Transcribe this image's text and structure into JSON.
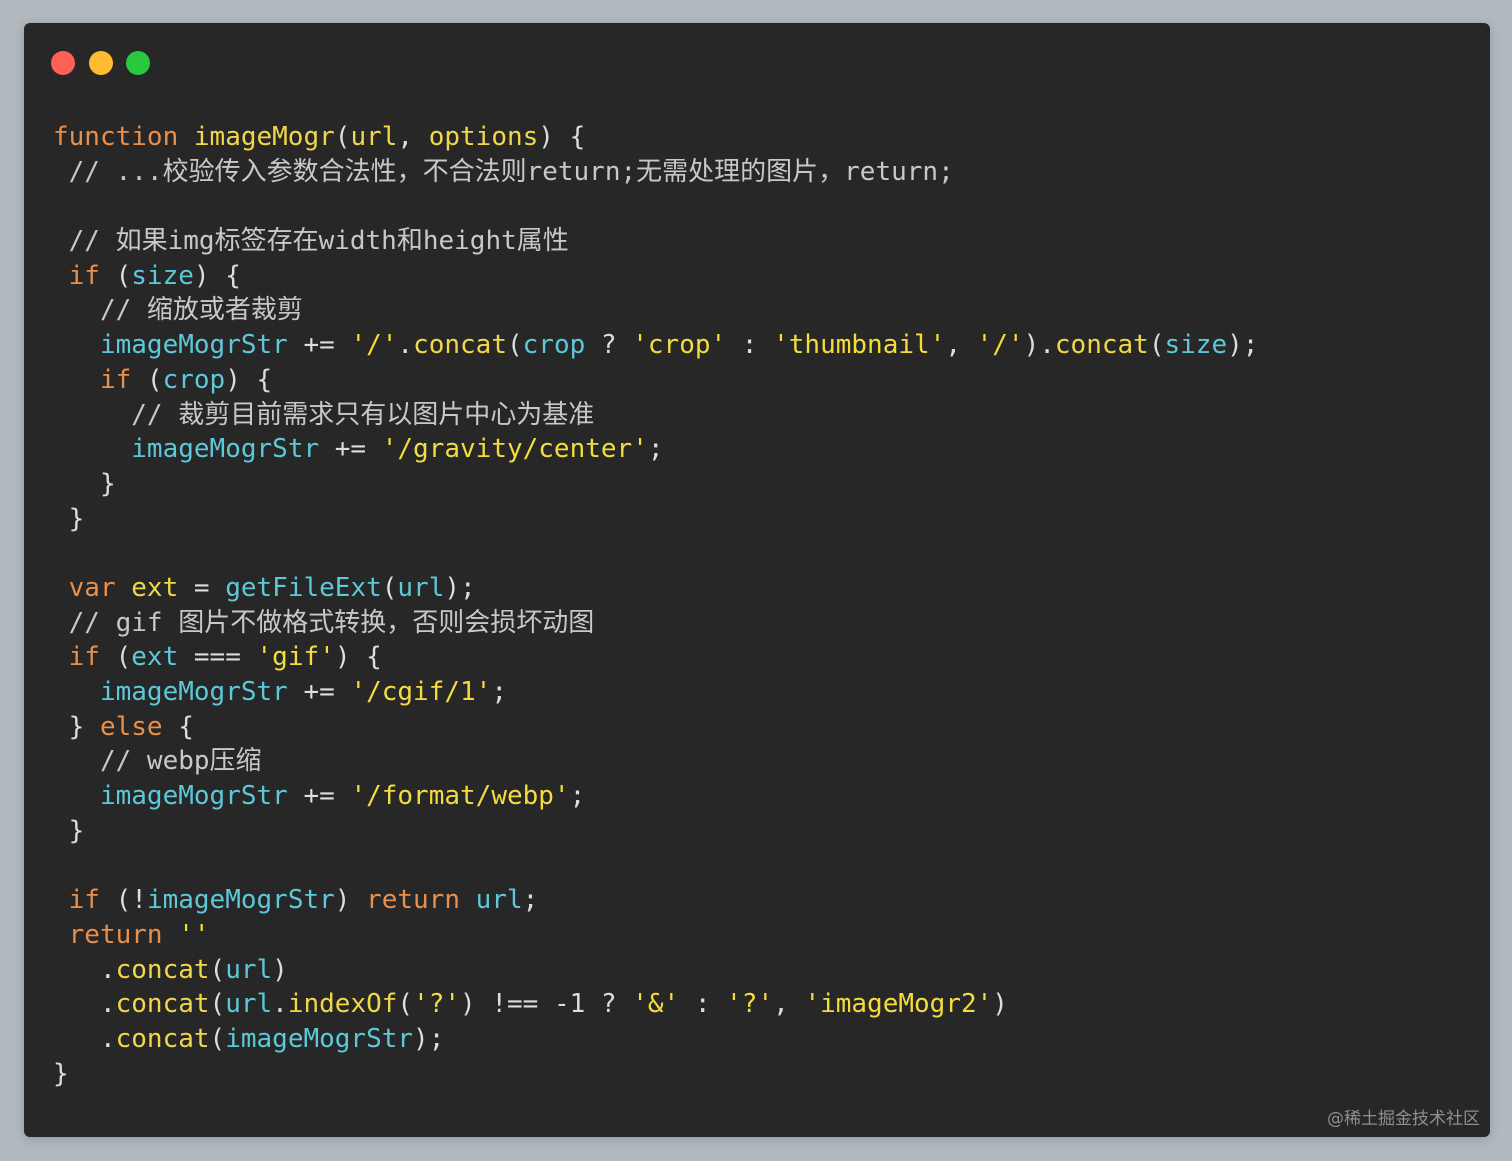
{
  "window": {
    "traffic_lights": [
      {
        "name": "close",
        "color": "#fe5f57"
      },
      {
        "name": "minimize",
        "color": "#febc2e"
      },
      {
        "name": "maximize",
        "color": "#28c840"
      }
    ]
  },
  "colors": {
    "keyword": "#e88f4c",
    "function_name": "#f0d74a",
    "param": "#f0d74a",
    "identifier": "#5cc8d8",
    "string": "#f3dc3c",
    "comment": "#c8c8c8",
    "punct": "#dddddd",
    "method": "#f0d74a"
  },
  "code": {
    "lines": [
      [
        [
          "keyword",
          "function"
        ],
        [
          "plain",
          " "
        ],
        [
          "function_name",
          "imageMogr"
        ],
        [
          "punct",
          "("
        ],
        [
          "param",
          "url"
        ],
        [
          "punct",
          ", "
        ],
        [
          "param",
          "options"
        ],
        [
          "punct",
          ") {"
        ]
      ],
      [
        [
          "comment",
          " // ...校验传入参数合法性，不合法则return;无需处理的图片，return;"
        ]
      ],
      [],
      [
        [
          "comment",
          " // 如果img标签存在width和height属性"
        ]
      ],
      [
        [
          "plain",
          " "
        ],
        [
          "keyword",
          "if"
        ],
        [
          "punct",
          " ("
        ],
        [
          "identifier",
          "size"
        ],
        [
          "punct",
          ") {"
        ]
      ],
      [
        [
          "comment",
          "   // 缩放或者裁剪"
        ]
      ],
      [
        [
          "plain",
          "   "
        ],
        [
          "identifier",
          "imageMogrStr"
        ],
        [
          "punct",
          " += "
        ],
        [
          "string",
          "'/'"
        ],
        [
          "punct",
          "."
        ],
        [
          "method",
          "concat"
        ],
        [
          "punct",
          "("
        ],
        [
          "identifier",
          "crop"
        ],
        [
          "punct",
          " ? "
        ],
        [
          "string",
          "'crop'"
        ],
        [
          "punct",
          " : "
        ],
        [
          "string",
          "'thumbnail'"
        ],
        [
          "punct",
          ", "
        ],
        [
          "string",
          "'/'"
        ],
        [
          "punct",
          ")."
        ],
        [
          "method",
          "concat"
        ],
        [
          "punct",
          "("
        ],
        [
          "identifier",
          "size"
        ],
        [
          "punct",
          ");"
        ]
      ],
      [
        [
          "plain",
          "   "
        ],
        [
          "keyword",
          "if"
        ],
        [
          "punct",
          " ("
        ],
        [
          "identifier",
          "crop"
        ],
        [
          "punct",
          ") {"
        ]
      ],
      [
        [
          "comment",
          "     // 裁剪目前需求只有以图片中心为基准"
        ]
      ],
      [
        [
          "plain",
          "     "
        ],
        [
          "identifier",
          "imageMogrStr"
        ],
        [
          "punct",
          " += "
        ],
        [
          "string",
          "'/gravity/center'"
        ],
        [
          "punct",
          ";"
        ]
      ],
      [
        [
          "punct",
          "   }"
        ]
      ],
      [
        [
          "punct",
          " }"
        ]
      ],
      [],
      [
        [
          "plain",
          " "
        ],
        [
          "keyword",
          "var"
        ],
        [
          "plain",
          " "
        ],
        [
          "function_name",
          "ext"
        ],
        [
          "punct",
          " = "
        ],
        [
          "identifier",
          "getFileExt"
        ],
        [
          "punct",
          "("
        ],
        [
          "identifier",
          "url"
        ],
        [
          "punct",
          ");"
        ]
      ],
      [
        [
          "comment",
          " // gif 图片不做格式转换，否则会损坏动图"
        ]
      ],
      [
        [
          "plain",
          " "
        ],
        [
          "keyword",
          "if"
        ],
        [
          "punct",
          " ("
        ],
        [
          "identifier",
          "ext"
        ],
        [
          "punct",
          " === "
        ],
        [
          "string",
          "'gif'"
        ],
        [
          "punct",
          ") {"
        ]
      ],
      [
        [
          "plain",
          "   "
        ],
        [
          "identifier",
          "imageMogrStr"
        ],
        [
          "punct",
          " += "
        ],
        [
          "string",
          "'/cgif/1'"
        ],
        [
          "punct",
          ";"
        ]
      ],
      [
        [
          "punct",
          " } "
        ],
        [
          "keyword",
          "else"
        ],
        [
          "punct",
          " {"
        ]
      ],
      [
        [
          "comment",
          "   // webp压缩"
        ]
      ],
      [
        [
          "plain",
          "   "
        ],
        [
          "identifier",
          "imageMogrStr"
        ],
        [
          "punct",
          " += "
        ],
        [
          "string",
          "'/format/webp'"
        ],
        [
          "punct",
          ";"
        ]
      ],
      [
        [
          "punct",
          " }"
        ]
      ],
      [],
      [
        [
          "plain",
          " "
        ],
        [
          "keyword",
          "if"
        ],
        [
          "punct",
          " (!"
        ],
        [
          "identifier",
          "imageMogrStr"
        ],
        [
          "punct",
          ") "
        ],
        [
          "keyword",
          "return"
        ],
        [
          "plain",
          " "
        ],
        [
          "identifier",
          "url"
        ],
        [
          "punct",
          ";"
        ]
      ],
      [
        [
          "plain",
          " "
        ],
        [
          "keyword",
          "return"
        ],
        [
          "plain",
          " "
        ],
        [
          "string",
          "''"
        ]
      ],
      [
        [
          "punct",
          "   ."
        ],
        [
          "method",
          "concat"
        ],
        [
          "punct",
          "("
        ],
        [
          "identifier",
          "url"
        ],
        [
          "punct",
          ")"
        ]
      ],
      [
        [
          "punct",
          "   ."
        ],
        [
          "method",
          "concat"
        ],
        [
          "punct",
          "("
        ],
        [
          "identifier",
          "url"
        ],
        [
          "punct",
          "."
        ],
        [
          "method",
          "indexOf"
        ],
        [
          "punct",
          "("
        ],
        [
          "string",
          "'?'"
        ],
        [
          "punct",
          ") !== -1 ? "
        ],
        [
          "string",
          "'&'"
        ],
        [
          "punct",
          " : "
        ],
        [
          "string",
          "'?'"
        ],
        [
          "punct",
          ", "
        ],
        [
          "string",
          "'imageMogr2'"
        ],
        [
          "punct",
          ")"
        ]
      ],
      [
        [
          "punct",
          "   ."
        ],
        [
          "method",
          "concat"
        ],
        [
          "punct",
          "("
        ],
        [
          "identifier",
          "imageMogrStr"
        ],
        [
          "punct",
          ");"
        ]
      ],
      [
        [
          "punct",
          "}"
        ]
      ]
    ]
  },
  "watermark": "@稀土掘金技术社区"
}
